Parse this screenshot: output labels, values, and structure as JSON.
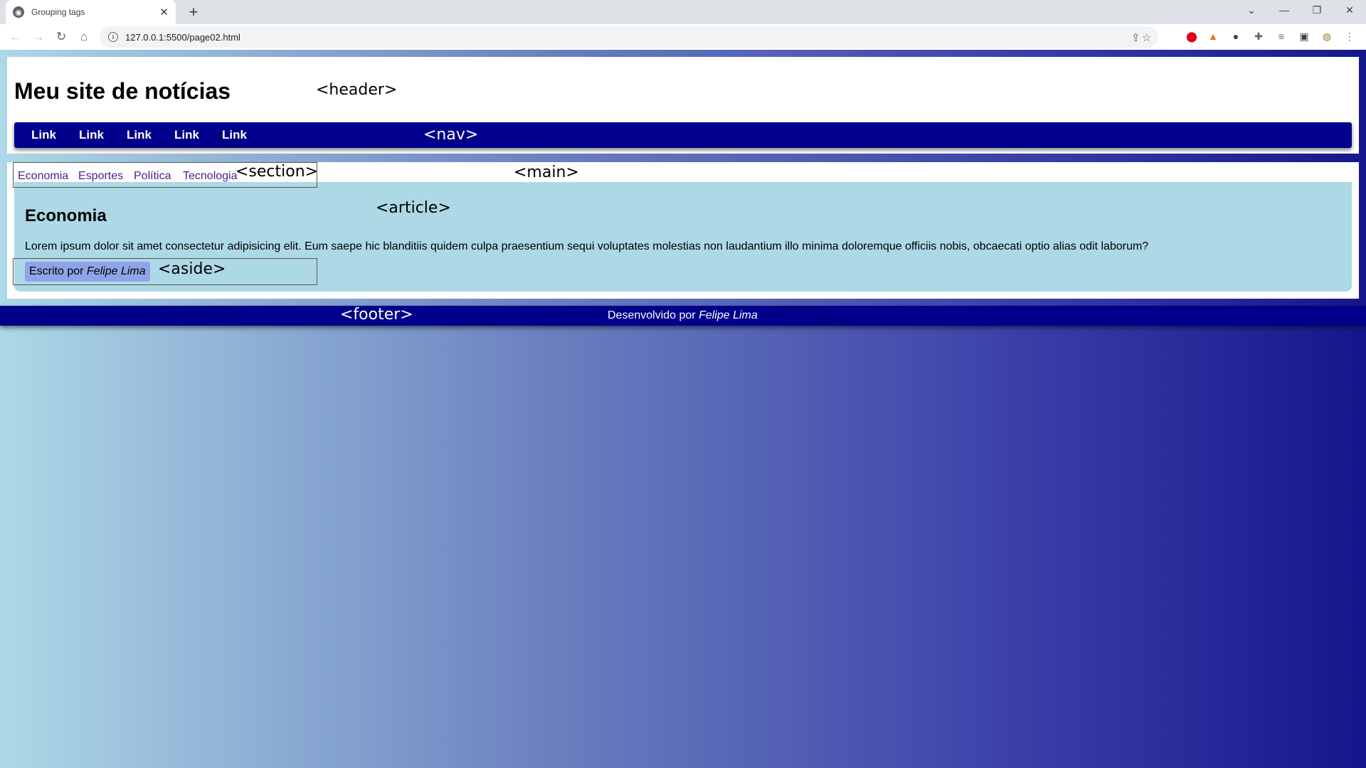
{
  "browser": {
    "tab_title": "Grouping tags",
    "tab_close": "✕",
    "new_tab": "+",
    "url": "127.0.0.1:5500/page02.html",
    "controls": {
      "list": "⌄",
      "minimize": "—",
      "restore": "❐",
      "close": "✕"
    },
    "nav": {
      "back": "←",
      "forward": "→",
      "reload": "↻",
      "home": "⌂"
    },
    "toolbar_icons": [
      "share-icon",
      "bookmark-star-icon",
      "opera-icon",
      "metamask-icon",
      "extension-cluster-icon",
      "puzzle-extensions-icon",
      "reading-list-icon",
      "side-panel-icon",
      "profile-avatar",
      "menu-kebab-icon"
    ]
  },
  "header": {
    "title": "Meu site de notícias",
    "tag": "<header>"
  },
  "nav": {
    "links": [
      "Link",
      "Link",
      "Link",
      "Link",
      "Link"
    ],
    "tag": "<nav>"
  },
  "main": {
    "tag": "<main>",
    "section": {
      "links": [
        "Economia",
        "Esportes",
        "Política",
        "Tecnologia"
      ],
      "tag": "<section>"
    },
    "article": {
      "tag": "<article>",
      "title": "Economia",
      "text": "Lorem ipsum dolor sit amet consectetur adipisicing elit. Eum saepe hic blanditiis quidem culpa praesentium sequi voluptates molestias non laudantium illo minima doloremque officiis nobis, obcaecati optio alias odit laborum?"
    },
    "aside": {
      "prefix": "Escrito por ",
      "author": "Felipe Lima",
      "tag": "<aside>"
    }
  },
  "footer": {
    "tag": "<footer>",
    "prefix": "Desenvolvido por ",
    "author": "Felipe Lima"
  },
  "colors": {
    "nav_bg": "#00008b",
    "article_bg": "#add8e6",
    "aside_badge_bg": "#8fa4e8",
    "visited_link": "#551a8b",
    "gradient_start": "#add8e6",
    "gradient_end": "#16168c"
  }
}
